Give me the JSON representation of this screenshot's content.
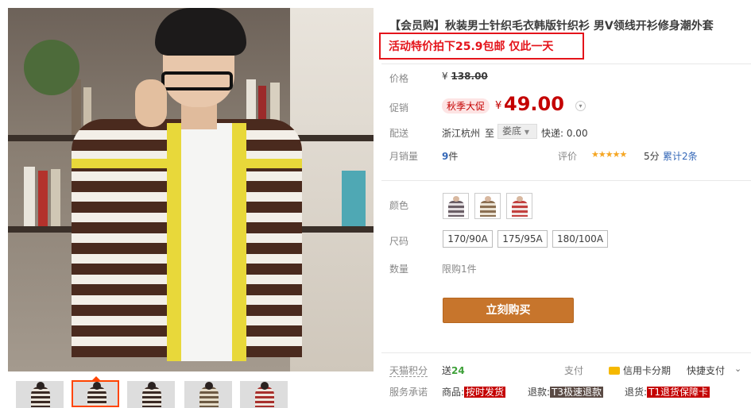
{
  "product": {
    "title": "【会员购】秋装男士针织毛衣韩版针织衫 男V领线开衫修身潮外套",
    "promo_text": "活动特价拍下25.9包邮 仅此一天"
  },
  "price_row": {
    "label": "价格",
    "currency": "¥",
    "original": "138.00"
  },
  "promo_row": {
    "label": "促销",
    "tag": "秋季大促",
    "currency": "¥",
    "price": "49.00",
    "toggle_icon": "chevron-down"
  },
  "shipping_row": {
    "label": "配送",
    "origin": "浙江杭州",
    "to": "至",
    "destination": "娄底",
    "express": "快递: 0.00"
  },
  "sales_row": {
    "label": "月销量",
    "count": "9",
    "unit": "件",
    "rating_label": "评价",
    "stars": "★★★★★",
    "score": "5分",
    "reviews": "累计2条"
  },
  "color_row": {
    "label": "颜色",
    "swatches": [
      {
        "name": "grey-stripe",
        "color": "#6a5e66"
      },
      {
        "name": "brown-stripe",
        "color": "#8b6f52"
      },
      {
        "name": "red-stripe",
        "color": "#c2403e"
      }
    ]
  },
  "size_row": {
    "label": "尺码",
    "options": [
      "170/90A",
      "175/95A",
      "180/100A"
    ]
  },
  "qty_row": {
    "label": "数量",
    "limit": "限购1件"
  },
  "buy_button": "立刻购买",
  "points_row": {
    "label": "天猫积分",
    "prefix": "送",
    "points": "24",
    "pay_label": "支付",
    "credit": "信用卡分期",
    "quick_pay": "快捷支付"
  },
  "service_row": {
    "label": "服务承诺",
    "goods": "商品:",
    "goods_badge": "按时发货",
    "refund": "退款:",
    "refund_badge": "T3极速退款",
    "return": "退货:",
    "return_badge": "T1退货保障卡"
  },
  "colors": {
    "accent": "#c40000",
    "buy_button": "#c7752c",
    "promo_border": "#e4141b"
  }
}
